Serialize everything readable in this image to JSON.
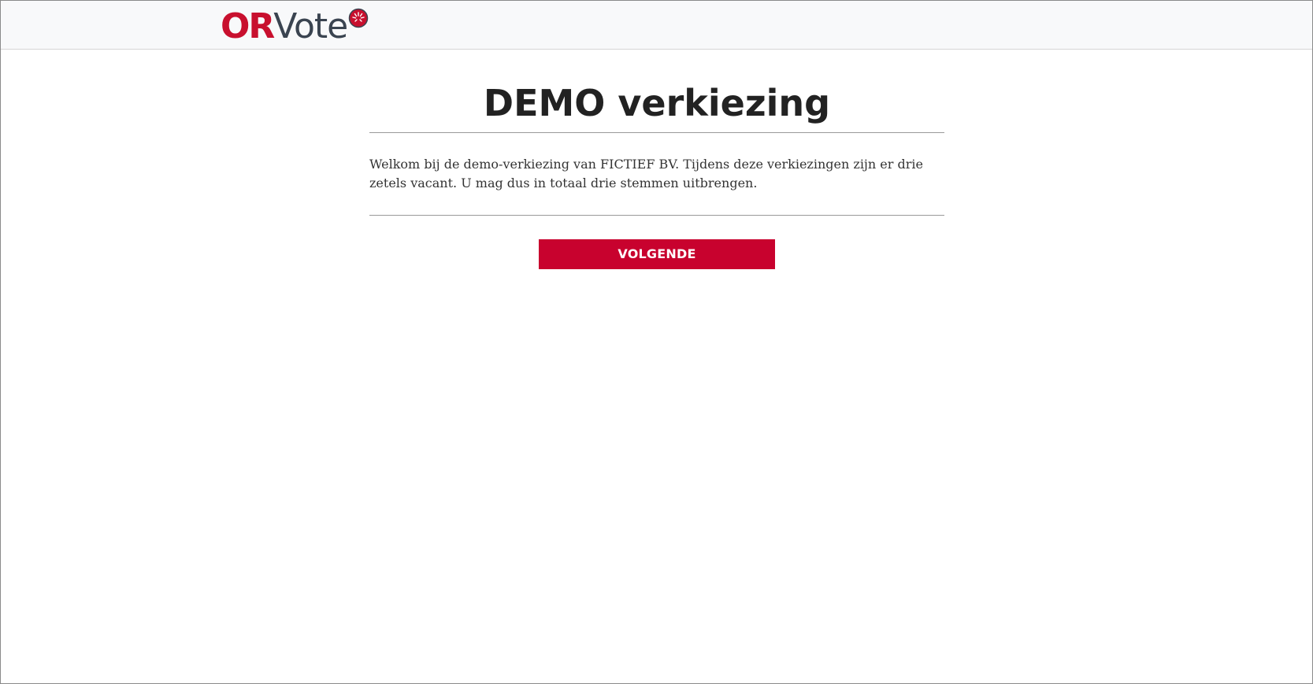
{
  "header": {
    "logo_or": "OR",
    "logo_vote": "Vote"
  },
  "colors": {
    "brand_red": "#c8102e",
    "button_red": "#c8022e",
    "logo_gray": "#3a4450",
    "header_bg": "#f8f9fa"
  },
  "icons": {
    "logo_mark": "red-circle-burst-icon"
  },
  "main": {
    "title": "DEMO verkiezing",
    "intro": "Welkom bij de demo-verkiezing van FICTIEF BV. Tijdens deze verkiezingen zijn er drie zetels vacant. U mag dus in totaal drie stemmen uitbrengen.",
    "next_button": "VOLGENDE"
  }
}
